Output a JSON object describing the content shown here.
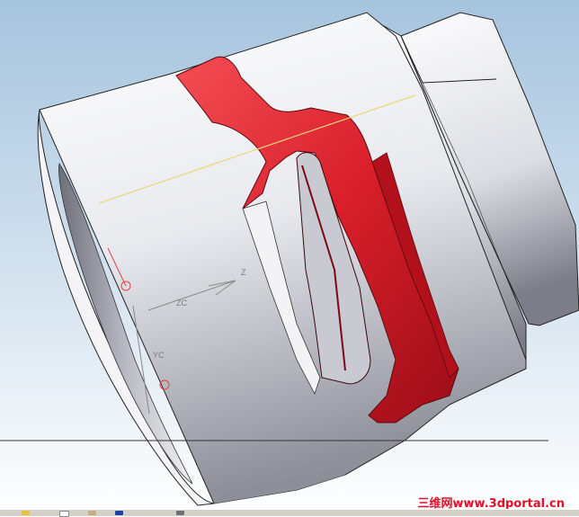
{
  "viewport": {
    "background_top": "#a8c6df",
    "background_bottom": "#ffffff",
    "model_color": "#e02630",
    "body_color": "#d8d9e0"
  },
  "axis_labels": {
    "z": "Z",
    "zc": "ZC",
    "yc": "YC"
  },
  "watermark": "三维网www.3dportal.cn",
  "taskbar_icons": [
    "folder-icon",
    "document-icon",
    "window-icon",
    "save-icon",
    "edit-icon"
  ]
}
